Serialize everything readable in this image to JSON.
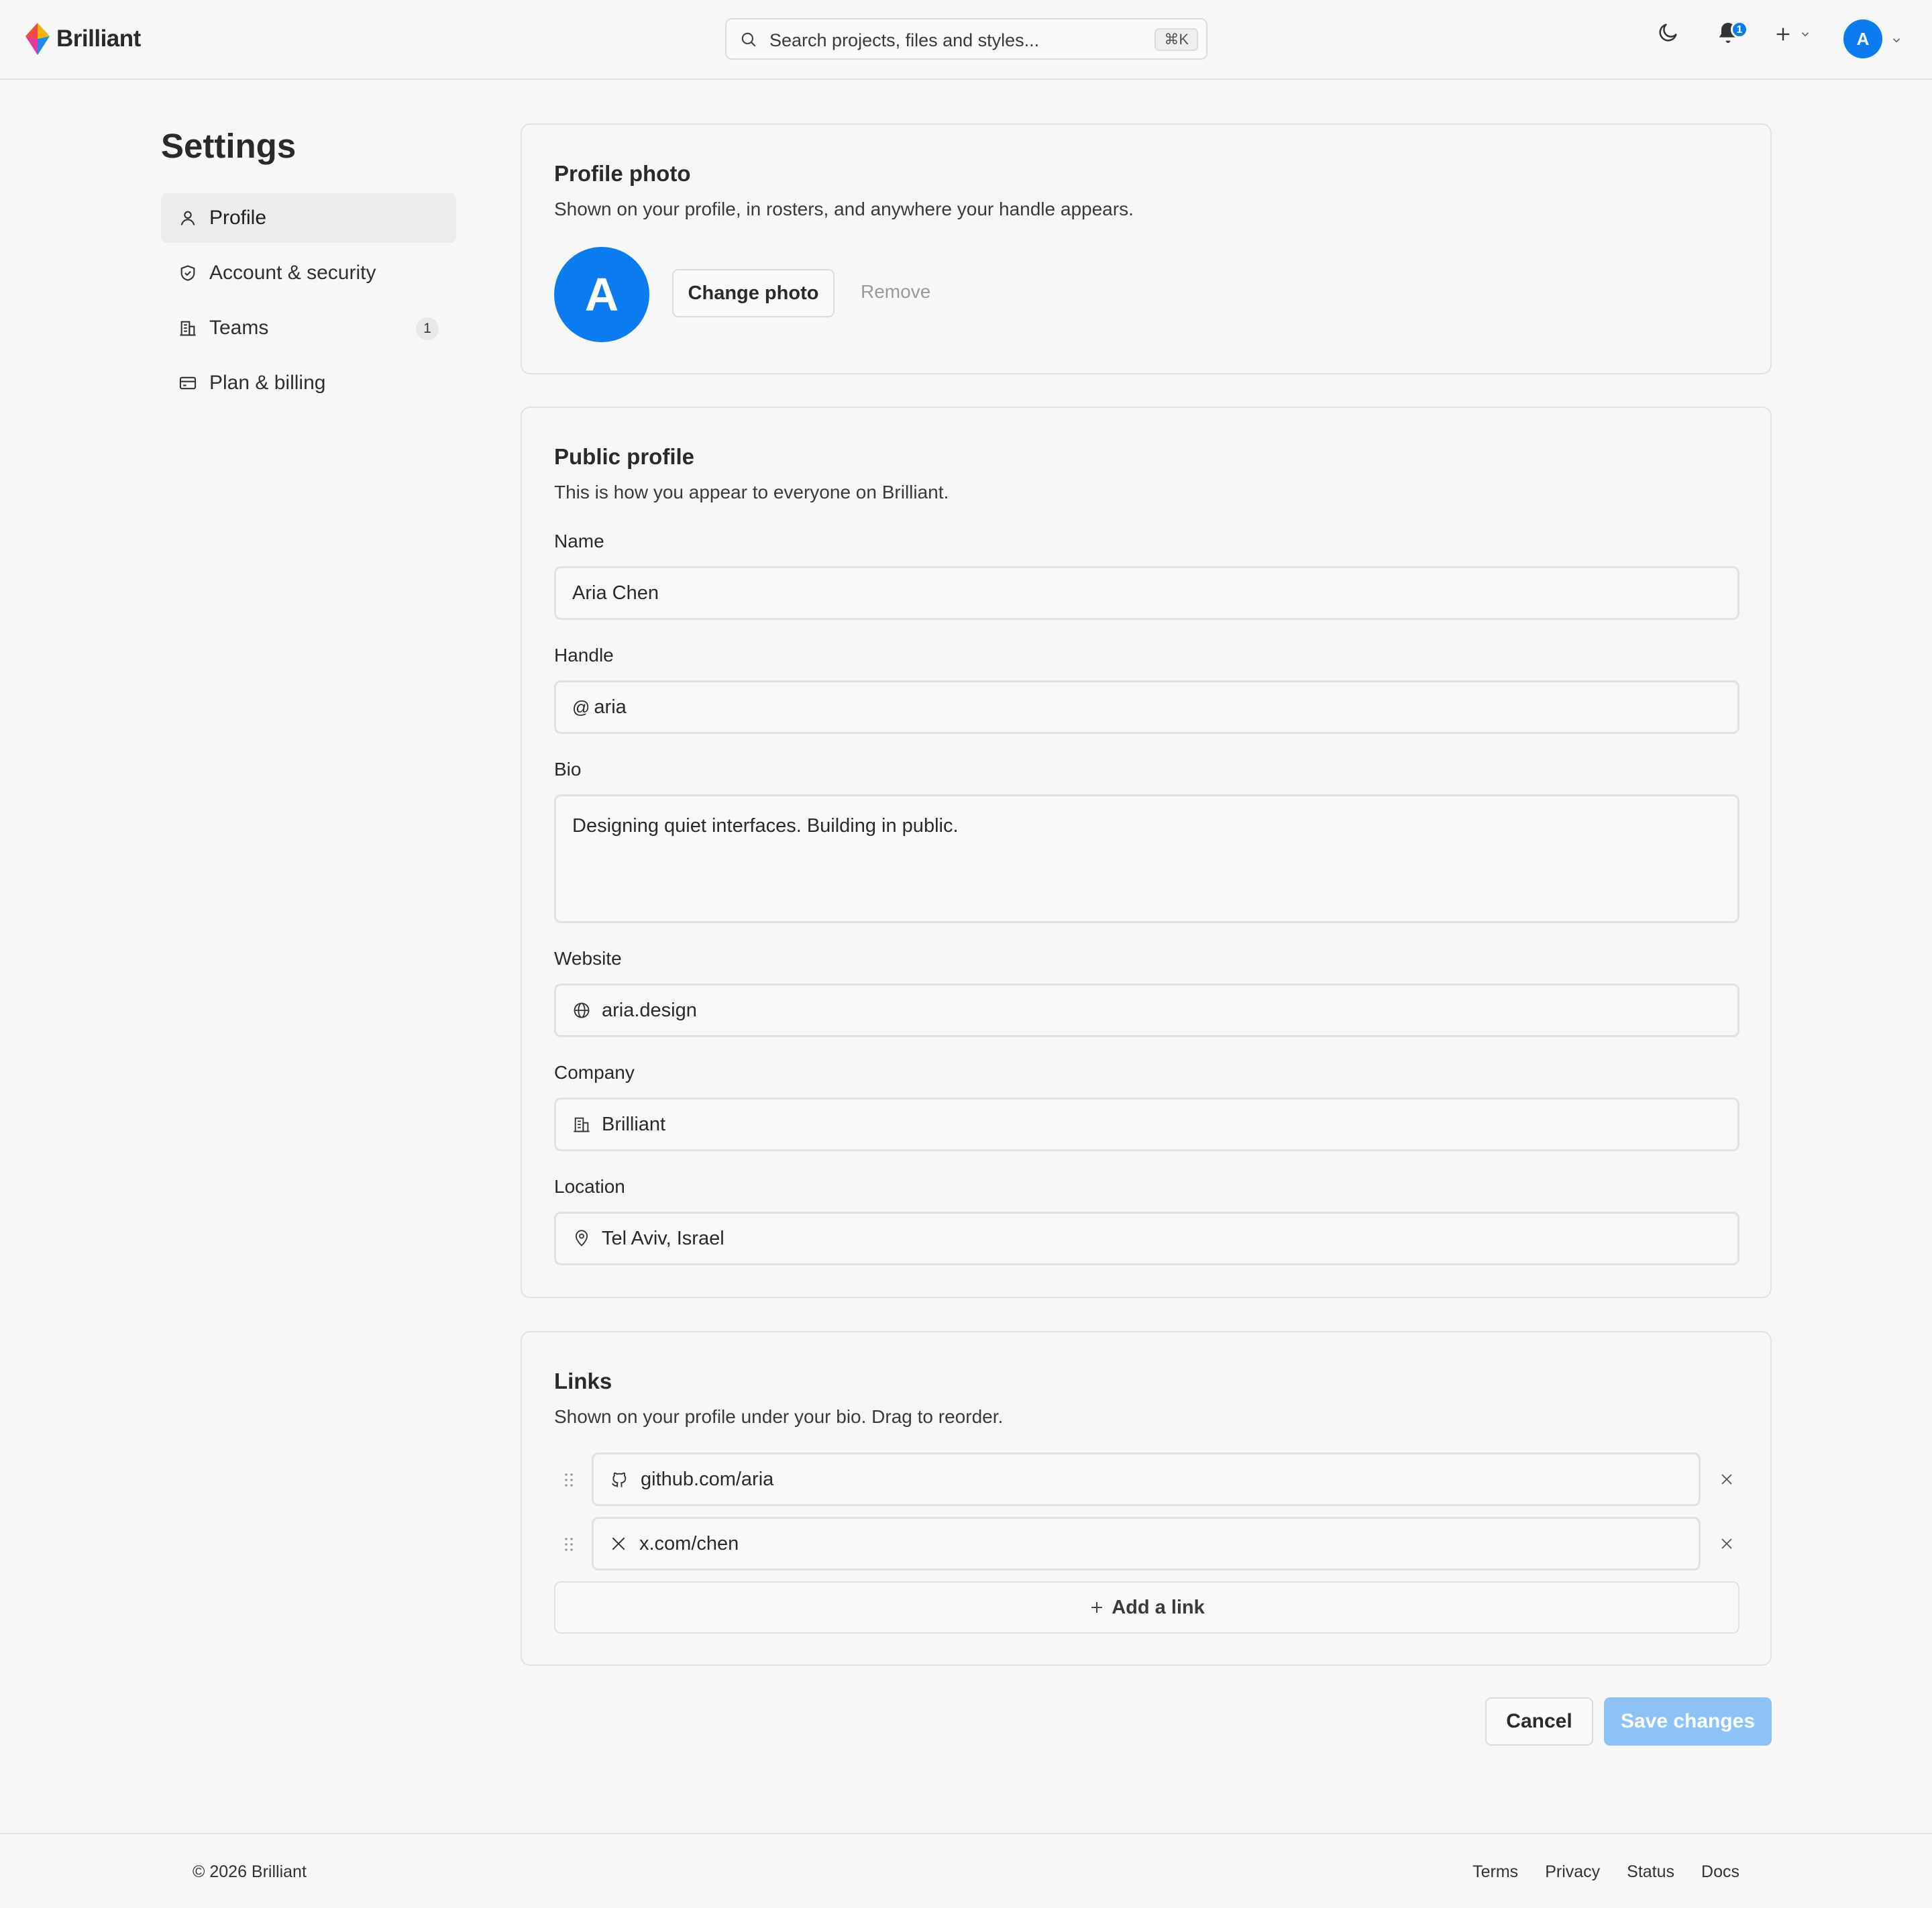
{
  "header": {
    "brand": "Brilliant",
    "search_placeholder": "Search projects, files and styles...",
    "search_shortcut": "⌘K",
    "notification_count": "1",
    "user_initial": "A"
  },
  "sidebar": {
    "title": "Settings",
    "items": [
      {
        "label": "Profile",
        "icon": "user-icon",
        "active": true
      },
      {
        "label": "Account & security",
        "icon": "shield-icon"
      },
      {
        "label": "Teams",
        "icon": "building-icon",
        "count": "1"
      },
      {
        "label": "Plan & billing",
        "icon": "card-icon"
      }
    ]
  },
  "photo_card": {
    "title": "Profile photo",
    "subtitle": "Shown on your profile, in rosters, and anywhere your handle appears.",
    "avatar_initial": "A",
    "change_label": "Change photo",
    "remove_label": "Remove"
  },
  "public_profile": {
    "title": "Public profile",
    "subtitle": "This is how you appear to everyone on Brilliant.",
    "name_label": "Name",
    "name_value": "Aria Chen",
    "handle_label": "Handle",
    "handle_prefix": "@",
    "handle_value": "aria",
    "bio_label": "Bio",
    "bio_value": "Designing quiet interfaces. Building in public.",
    "website_label": "Website",
    "website_value": "aria.design",
    "company_label": "Company",
    "company_value": "Brilliant",
    "location_label": "Location",
    "location_value": "Tel Aviv, Israel"
  },
  "links": {
    "title": "Links",
    "subtitle": "Shown on your profile under your bio. Drag to reorder.",
    "items": [
      {
        "value": "github.com/aria",
        "icon": "github-icon"
      },
      {
        "value": "x.com/chen",
        "icon": "x-logo-icon"
      }
    ],
    "add_label": "Add a link"
  },
  "actions": {
    "cancel_label": "Cancel",
    "save_label": "Save changes"
  },
  "footer": {
    "copyright": "© 2026 Brilliant",
    "links": [
      "Terms",
      "Privacy",
      "Status",
      "Docs"
    ]
  },
  "colors": {
    "accent": "#0a7cf0",
    "save_disabled": "#8cc2f5",
    "background": "#f7f7f7"
  }
}
